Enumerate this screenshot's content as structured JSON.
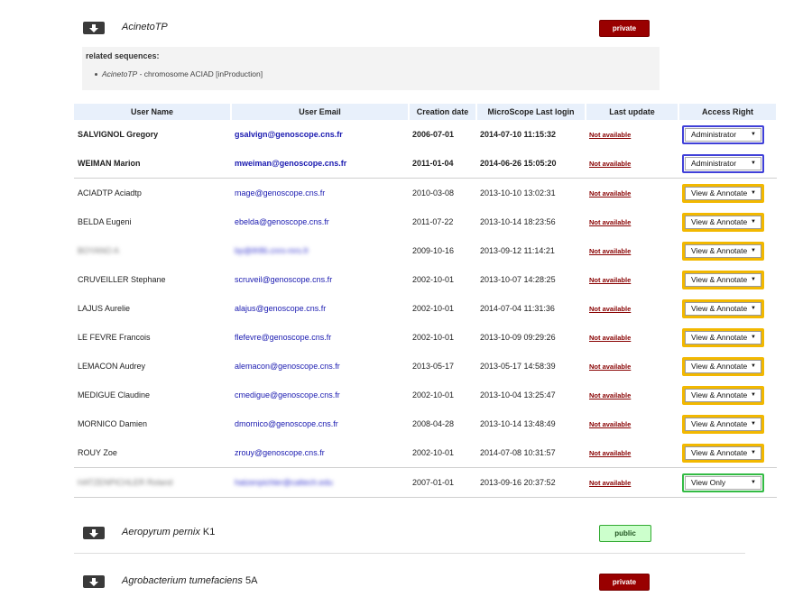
{
  "projects": [
    {
      "name": "AcinetoTP",
      "strain": "",
      "visibility": "private"
    },
    {
      "name": "Aeropyrum pernix",
      "strain": "K1",
      "visibility": "public"
    },
    {
      "name": "Agrobacterium tumefaciens",
      "strain": "5A",
      "visibility": "private"
    }
  ],
  "related": {
    "title": "related sequences:",
    "item_name": "AcinetoTP",
    "item_desc": " - chromosome ACIAD [inProduction]"
  },
  "table": {
    "headers": [
      "User Name",
      "User Email",
      "Creation date",
      "MicroScope Last login",
      "Last update",
      "Access Right"
    ],
    "rows": [
      {
        "name": "SALVIGNOL Gregory",
        "email": "gsalvign@genoscope.cns.fr",
        "created": "2006-07-01",
        "last_login": "2014-07-10 11:15:32",
        "last_update": "Not available",
        "access": "Administrator"
      },
      {
        "name": "WEIMAN Marion",
        "email": "mweiman@genoscope.cns.fr",
        "created": "2011-01-04",
        "last_login": "2014-06-26 15:05:20",
        "last_update": "Not available",
        "access": "Administrator"
      },
      {
        "name": "ACIADTP Aciadtp",
        "email": "mage@genoscope.cns.fr",
        "created": "2010-03-08",
        "last_login": "2013-10-10 13:02:31",
        "last_update": "Not available",
        "access": "View & Annotate"
      },
      {
        "name": "BELDA Eugeni",
        "email": "ebelda@genoscope.cns.fr",
        "created": "2011-07-22",
        "last_login": "2013-10-14 18:23:56",
        "last_update": "Not available",
        "access": "View & Annotate"
      },
      {
        "name": "BOYANO A",
        "email": "bp@ifr86.cnrs-mrs.fr",
        "created": "2009-10-16",
        "last_login": "2013-09-12 11:14:21",
        "last_update": "Not available",
        "access": "View & Annotate"
      },
      {
        "name": "CRUVEILLER Stephane",
        "email": "scruveil@genoscope.cns.fr",
        "created": "2002-10-01",
        "last_login": "2013-10-07 14:28:25",
        "last_update": "Not available",
        "access": "View & Annotate"
      },
      {
        "name": "LAJUS Aurelie",
        "email": "alajus@genoscope.cns.fr",
        "created": "2002-10-01",
        "last_login": "2014-07-04 11:31:36",
        "last_update": "Not available",
        "access": "View & Annotate"
      },
      {
        "name": "LE FEVRE Francois",
        "email": "flefevre@genoscope.cns.fr",
        "created": "2002-10-01",
        "last_login": "2013-10-09 09:29:26",
        "last_update": "Not available",
        "access": "View & Annotate"
      },
      {
        "name": "LEMACON Audrey",
        "email": "alemacon@genoscope.cns.fr",
        "created": "2013-05-17",
        "last_login": "2013-05-17 14:58:39",
        "last_update": "Not available",
        "access": "View & Annotate"
      },
      {
        "name": "MEDIGUE Claudine",
        "email": "cmedigue@genoscope.cns.fr",
        "created": "2002-10-01",
        "last_login": "2013-10-04 13:25:47",
        "last_update": "Not available",
        "access": "View & Annotate"
      },
      {
        "name": "MORNICO Damien",
        "email": "dmornico@genoscope.cns.fr",
        "created": "2008-04-28",
        "last_login": "2013-10-14 13:48:49",
        "last_update": "Not available",
        "access": "View & Annotate"
      },
      {
        "name": "ROUY Zoe",
        "email": "zrouy@genoscope.cns.fr",
        "created": "2002-10-01",
        "last_login": "2014-07-08 10:31:57",
        "last_update": "Not available",
        "access": "View & Annotate"
      },
      {
        "name": "HATZENPICHLER Roland",
        "email": "hatzenpichler@caltech.edu",
        "created": "2007-01-01",
        "last_login": "2013-09-16 20:37:52",
        "last_update": "Not available",
        "access": "View Only"
      }
    ]
  },
  "colors": {
    "private": "#990000",
    "public": "#ccffcc",
    "admin_border": "#4040d8",
    "annotate_border": "#f2b800",
    "viewonly_border": "#33bb44",
    "header_bg": "#e8f0fb"
  },
  "icons": {
    "expand": "download-arrow-icon",
    "dropdown": "caret-down-icon"
  }
}
